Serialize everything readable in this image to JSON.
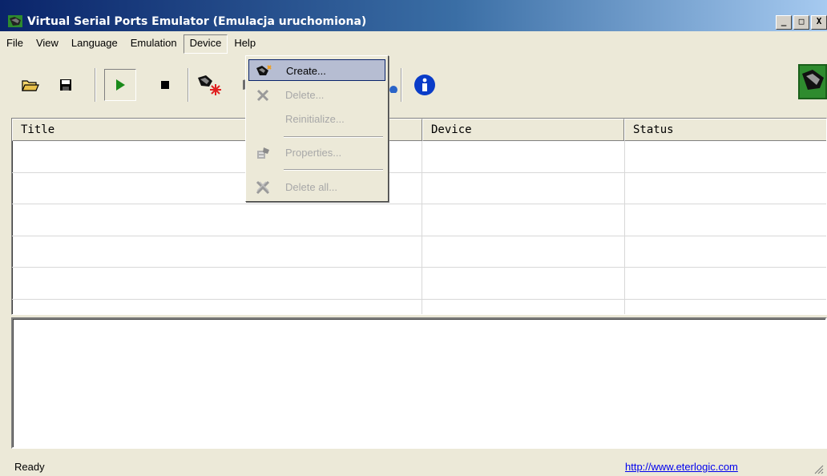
{
  "window": {
    "title": "Virtual Serial Ports Emulator (Emulacja uruchomiona)",
    "controls": [
      "_",
      "□",
      "X"
    ]
  },
  "menubar": {
    "items": [
      "File",
      "View",
      "Language",
      "Emulation",
      "Device",
      "Help"
    ],
    "open_item": "Device"
  },
  "toolbar": {
    "buttons": [
      "open-folder-icon",
      "save-icon",
      "play-icon",
      "stop-icon",
      "create-device-icon",
      "delete-device-icon",
      "network-icon",
      "info-icon"
    ],
    "pressed": "play-icon",
    "accent_green": "#1a8a1a"
  },
  "device_menu": {
    "items": [
      {
        "label": "Create...",
        "icon": "create-device-icon",
        "enabled": true,
        "highlighted": true
      },
      {
        "label": "Delete...",
        "icon": "delete-icon",
        "enabled": false
      },
      {
        "label": "Reinitialize...",
        "icon": "",
        "enabled": false
      },
      {
        "label": "Properties...",
        "icon": "properties-icon",
        "enabled": false
      },
      {
        "label": "Delete all...",
        "icon": "delete-all-icon",
        "enabled": false
      }
    ]
  },
  "listview": {
    "columns": [
      "Title",
      "Device",
      "Status"
    ],
    "rows": []
  },
  "statusbar": {
    "text": "Ready",
    "link": "http://www.eterlogic.com"
  }
}
